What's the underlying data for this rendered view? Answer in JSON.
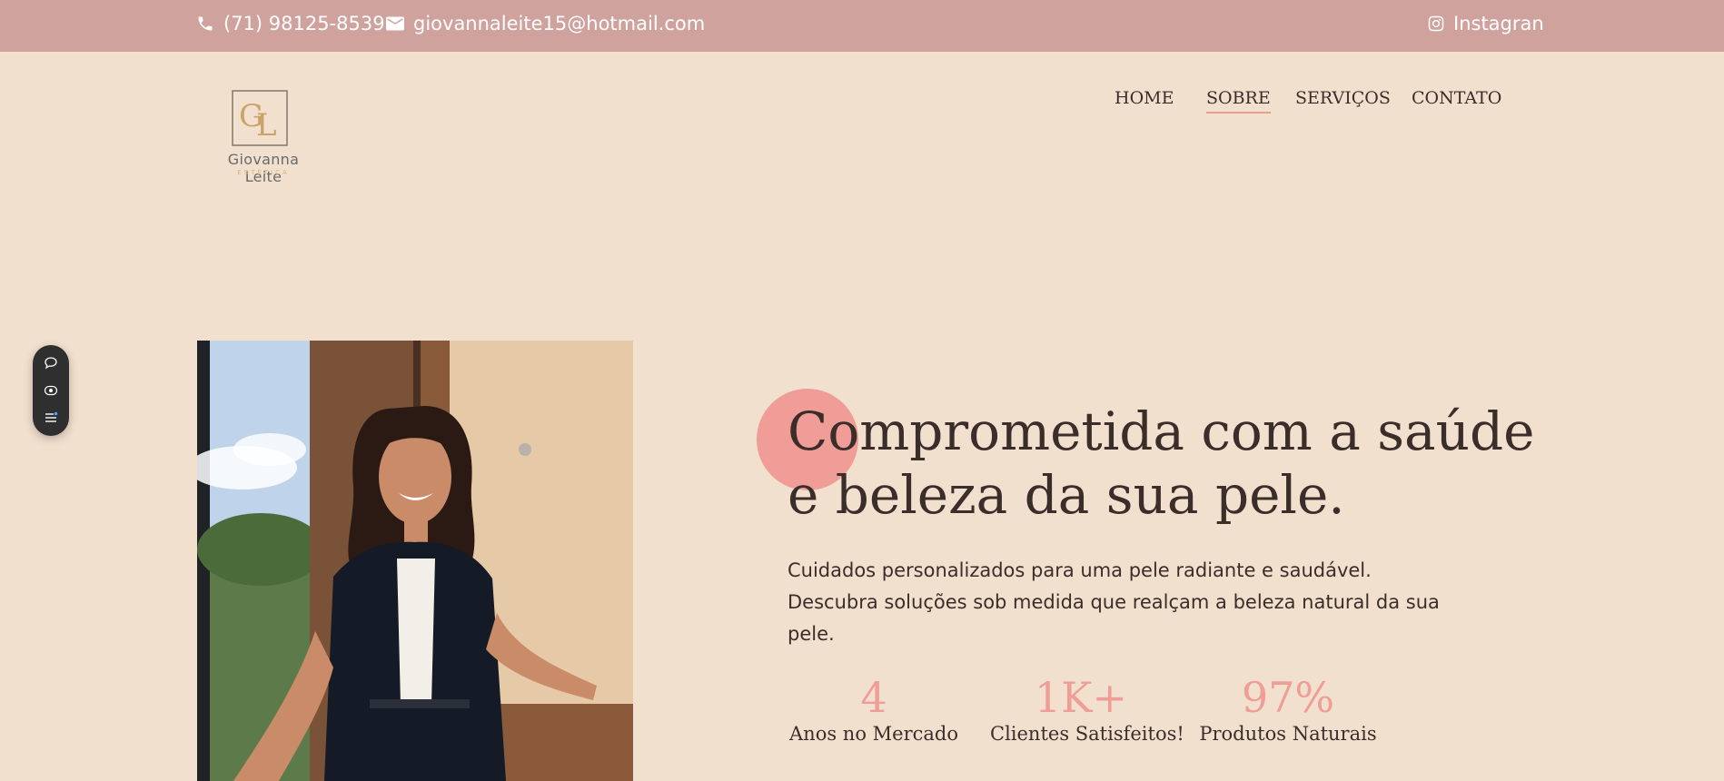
{
  "topbar": {
    "phone": "(71) 98125-8539",
    "email": "giovannaleite15@hotmail.com",
    "social": "Instagran",
    "icons": [
      "phone-icon",
      "mail-icon",
      "instagram-icon"
    ]
  },
  "logo": {
    "name": "Giovanna Leite",
    "subtitle": "ESTÉTICA"
  },
  "nav": {
    "items": [
      {
        "label": "HOME"
      },
      {
        "label": "SOBRE",
        "active": true
      },
      {
        "label": "SERVIÇOS"
      },
      {
        "label": "CONTATO"
      }
    ]
  },
  "hero": {
    "headline_line1": "Comprometida com a saúde",
    "headline_line2": "e beleza da sua pele.",
    "description": "Cuidados personalizados para uma pele radiante e saudável. Descubra soluções sob medida que realçam a beleza natural da sua pele."
  },
  "stats": [
    {
      "value": "4",
      "label": "Anos no Mercado"
    },
    {
      "value": "1K+",
      "label": "Clientes Satisfeitos!"
    },
    {
      "value": "97%",
      "label": "Produtos Naturais"
    }
  ],
  "colors": {
    "topbar": "#d0a29d",
    "background": "#f2e0cf",
    "accent": "#ef9d96",
    "text": "#3b2d2a"
  },
  "toolbar_icons": [
    "comment-icon",
    "eye-icon",
    "list-icon"
  ]
}
